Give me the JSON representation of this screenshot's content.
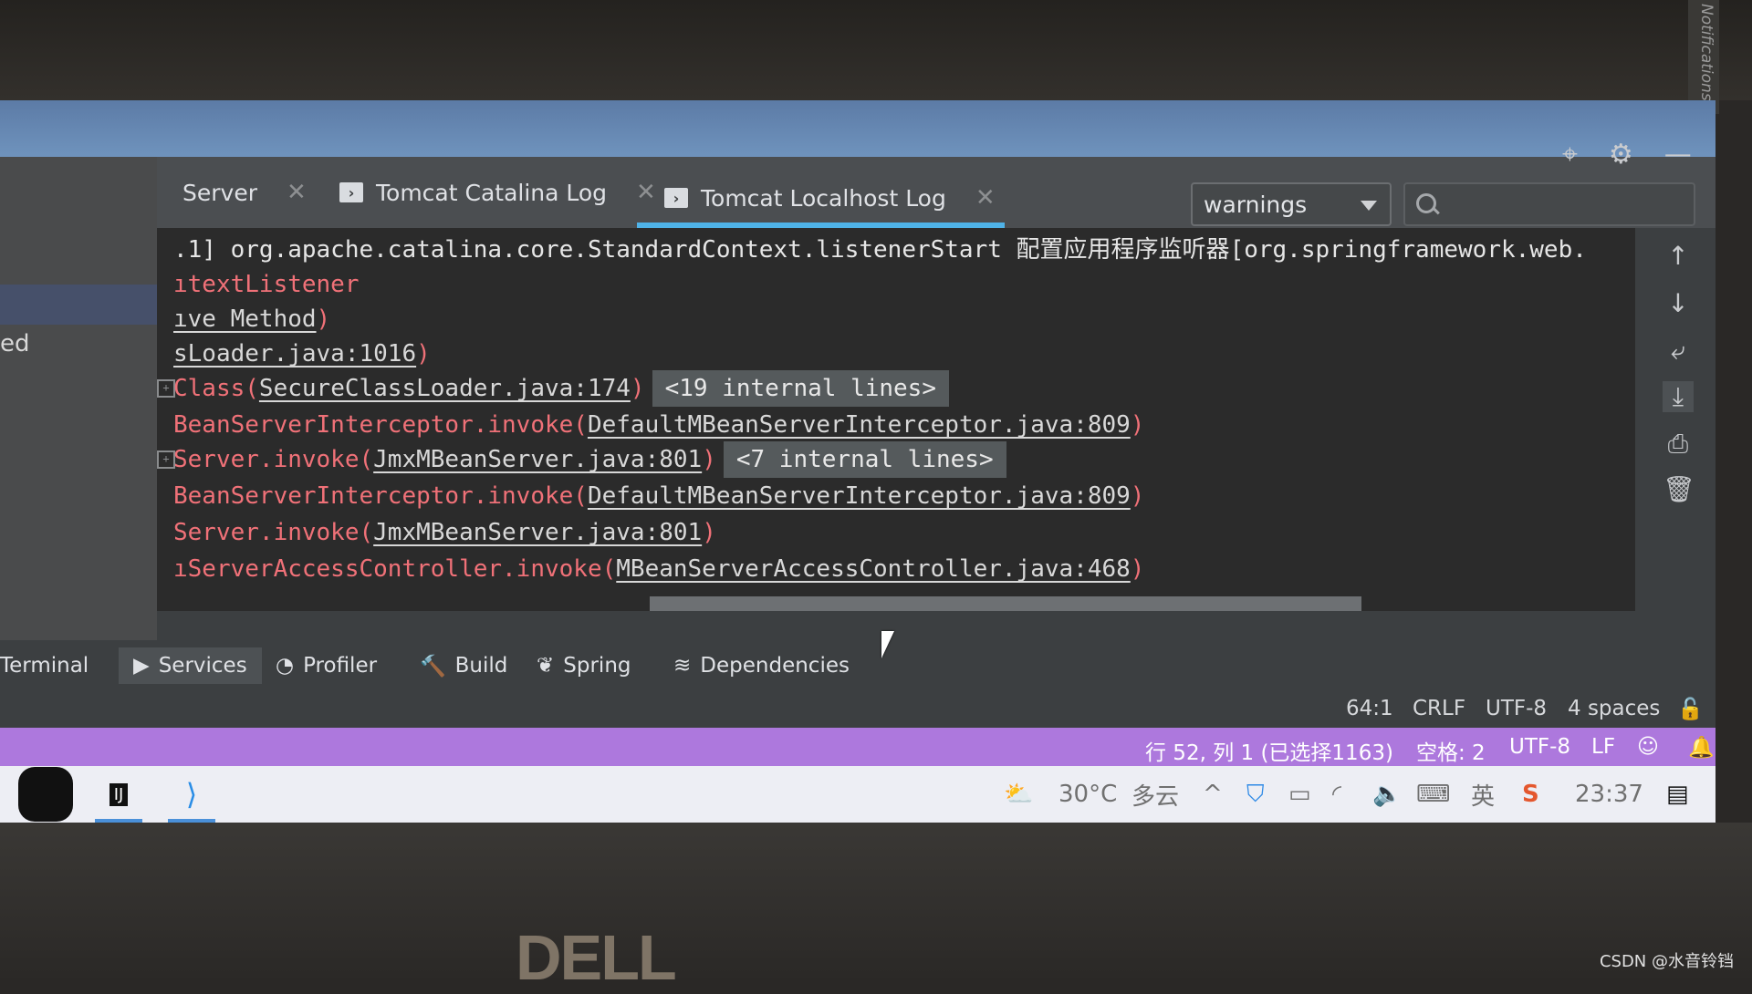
{
  "notifications_label": "Notifications",
  "left_panel": {
    "partial_text": "ed"
  },
  "tabs": [
    {
      "label": "Server",
      "closable": true,
      "active": false,
      "icon": "none"
    },
    {
      "label": "Tomcat Catalina Log",
      "closable": true,
      "active": false,
      "icon": "console-icon"
    },
    {
      "label": "Tomcat Localhost Log",
      "closable": true,
      "active": true,
      "icon": "console-icon"
    }
  ],
  "filter": {
    "selected": "warnings"
  },
  "search": {
    "placeholder": ""
  },
  "toolbar_icons": [
    "crosshair-icon",
    "gear-icon",
    "minimize-icon"
  ],
  "console": {
    "lines": [
      {
        "prefix": ".1] org.apache.catalina.core.StandardContext.listenerStart ",
        "cn": "配置应用程序监听器",
        "suffix": "[org.springframework.web."
      },
      {
        "red": "ıtextListener"
      },
      {
        "link": "ıve Method",
        "close": ")"
      },
      {
        "link": "sLoader.java:1016",
        "close": ")"
      },
      {
        "red": "Class(",
        "link": "SecureClassLoader.java:174",
        "close": ")",
        "fold": "<19 internal lines>"
      },
      {
        "red": "BeanServerInterceptor.invoke(",
        "link": "DefaultMBeanServerInterceptor.java:809",
        "close": ")"
      },
      {
        "red": "Server.invoke(",
        "link": "JmxMBeanServer.java:801",
        "close": ")",
        "fold": "<7 internal lines>"
      },
      {
        "red": "BeanServerInterceptor.invoke(",
        "link": "DefaultMBeanServerInterceptor.java:809",
        "close": ")"
      },
      {
        "red": "Server.invoke(",
        "link": "JmxMBeanServer.java:801",
        "close": ")"
      },
      {
        "red": "ıServerAccessController.invoke(",
        "link": "MBeanServerAccessController.java:468",
        "close": ")"
      }
    ]
  },
  "right_gutter_icons": [
    "up-arrow-icon",
    "down-arrow-icon",
    "soft-wrap-icon",
    "scroll-to-end-icon",
    "print-icon",
    "trash-icon"
  ],
  "bottom_tabs": [
    {
      "label": "Terminal",
      "icon": "terminal-icon"
    },
    {
      "label": "Services",
      "icon": "services-icon",
      "active": true
    },
    {
      "label": "Profiler",
      "icon": "profiler-icon"
    },
    {
      "label": "Build",
      "icon": "hammer-icon"
    },
    {
      "label": "Spring",
      "icon": "spring-leaf-icon"
    },
    {
      "label": "Dependencies",
      "icon": "dependencies-icon"
    }
  ],
  "status_bar": {
    "position": "64:1",
    "line_sep": "CRLF",
    "encoding": "UTF-8",
    "indent": "4 spaces"
  },
  "vscode_status": {
    "cursor": "行 52, 列 1 (已选择1163)",
    "spaces": "空格: 2",
    "encoding": "UTF-8",
    "eol": "LF"
  },
  "taskbar": {
    "temperature": "30°C",
    "weather": "多云",
    "ime": "英",
    "time": "23:37"
  },
  "brand": "DELL",
  "watermark": "CSDN @水音铃铛",
  "colors": {
    "accent_underline": "#4fb3e8",
    "vscode_status": "#ad78dd",
    "error_text": "#f07178"
  }
}
